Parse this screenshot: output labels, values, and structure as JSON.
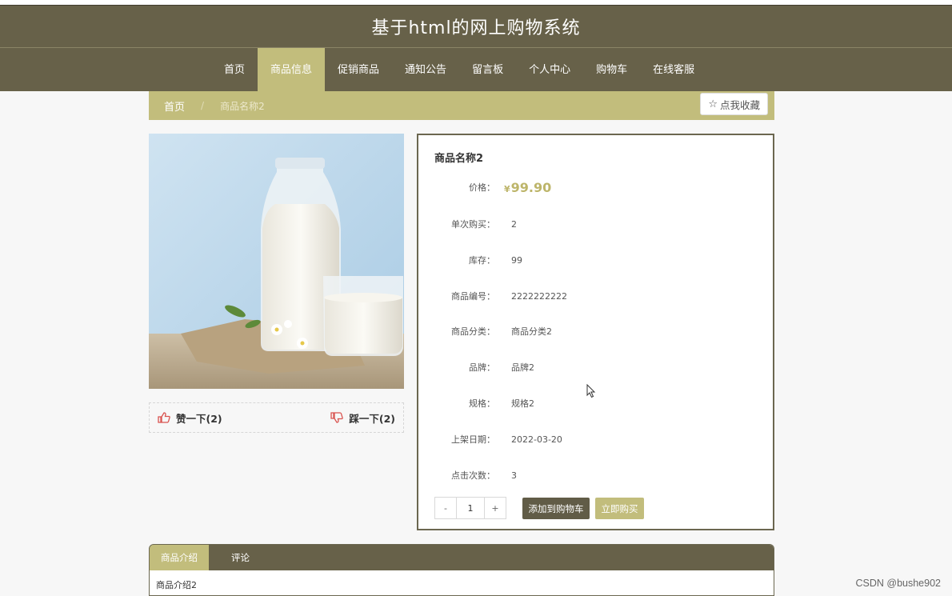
{
  "site": {
    "title": "基于html的网上购物系统"
  },
  "nav": {
    "items": [
      {
        "label": "首页"
      },
      {
        "label": "商品信息",
        "active": true
      },
      {
        "label": "促销商品"
      },
      {
        "label": "通知公告"
      },
      {
        "label": "留言板"
      },
      {
        "label": "个人中心"
      },
      {
        "label": "购物车"
      },
      {
        "label": "在线客服"
      }
    ]
  },
  "breadcrumb": {
    "home": "首页",
    "current": "商品名称2",
    "separator": "/"
  },
  "favorite": {
    "label": "点我收藏",
    "icon": "star-outline-icon"
  },
  "votes": {
    "like_label": "赞一下(2)",
    "dislike_label": "踩一下(2)"
  },
  "product": {
    "name": "商品名称2",
    "price_symbol": "¥",
    "price": "99.90",
    "fields": [
      {
        "label": "价格：",
        "value": ""
      },
      {
        "label": "单次购买：",
        "value": "2"
      },
      {
        "label": "库存：",
        "value": "99"
      },
      {
        "label": "商品编号：",
        "value": "2222222222"
      },
      {
        "label": "商品分类：",
        "value": "商品分类2"
      },
      {
        "label": "品牌：",
        "value": "品牌2"
      },
      {
        "label": "规格：",
        "value": "规格2"
      },
      {
        "label": "上架日期：",
        "value": "2022-03-20"
      },
      {
        "label": "点击次数：",
        "value": "3"
      }
    ]
  },
  "purchase": {
    "minus": "-",
    "quantity": "1",
    "plus": "+",
    "add_cart_label": "添加到购物车",
    "buy_now_label": "立即购买"
  },
  "tabs": {
    "items": [
      {
        "label": "商品介绍",
        "active": true
      },
      {
        "label": "评论"
      }
    ],
    "content": "商品介绍2"
  },
  "watermark": "CSDN @bushe902",
  "colors": {
    "header": "#676149",
    "accent": "#c2bd7c",
    "price": "#bdb56a",
    "button_dark": "#615c47"
  }
}
